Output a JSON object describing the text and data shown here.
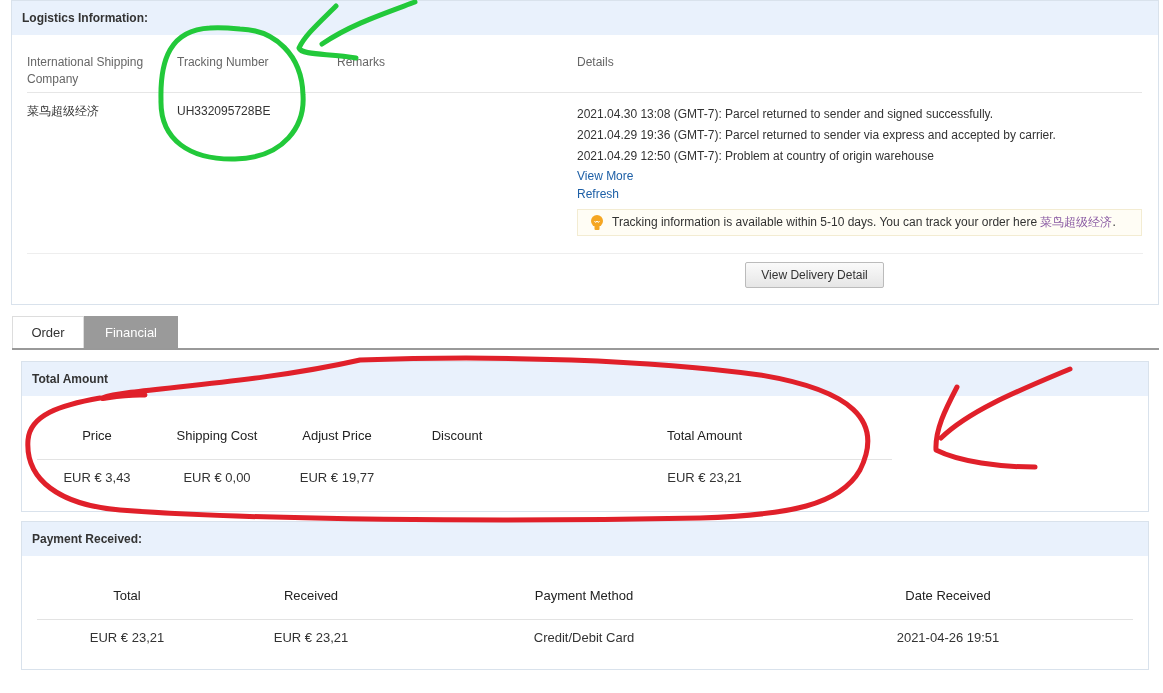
{
  "logistics": {
    "title": "Logistics Information:",
    "columns": [
      "International Shipping Company",
      "Tracking Number",
      "Remarks",
      "Details"
    ],
    "company": "菜鸟超级经济",
    "tracking_number": "UH332095728BE",
    "events": [
      "2021.04.30 13:08 (GMT-7): Parcel returned to sender and signed successfully.",
      "2021.04.29 19:36 (GMT-7): Parcel returned to sender via express and accepted by carrier.",
      "2021.04.29 12:50 (GMT-7): Problem at country of origin warehouse"
    ],
    "links": [
      "View More",
      "Refresh"
    ],
    "notice": {
      "text": "Tracking information is available within 5-10 days. You can track your order here ",
      "link": "菜鸟超级经济",
      "after": "."
    },
    "button": "View Delivery Detail"
  },
  "tabs": [
    {
      "label": "Order",
      "selected": false
    },
    {
      "label": "Financial",
      "selected": true
    }
  ],
  "total_amount": {
    "title": "Total Amount",
    "columns": [
      {
        "label": "Price",
        "value": "EUR € 3,43"
      },
      {
        "label": "Shipping Cost",
        "value": "EUR € 0,00"
      },
      {
        "label": "Adjust Price",
        "value": "EUR € 19,77"
      },
      {
        "label": "Discount"
      },
      {
        "label": "Total Amount",
        "value": "EUR € 23,21"
      }
    ]
  },
  "payment_received": {
    "title": "Payment Received:",
    "columns": [
      {
        "label": "Total",
        "value": "EUR € 23,21"
      },
      {
        "label": "Received",
        "value": "EUR € 23,21"
      },
      {
        "label": "Payment Method",
        "value": "Credit/Debit Card"
      },
      {
        "label": "Date Received",
        "value": "2021-04-26 19:51"
      }
    ]
  }
}
